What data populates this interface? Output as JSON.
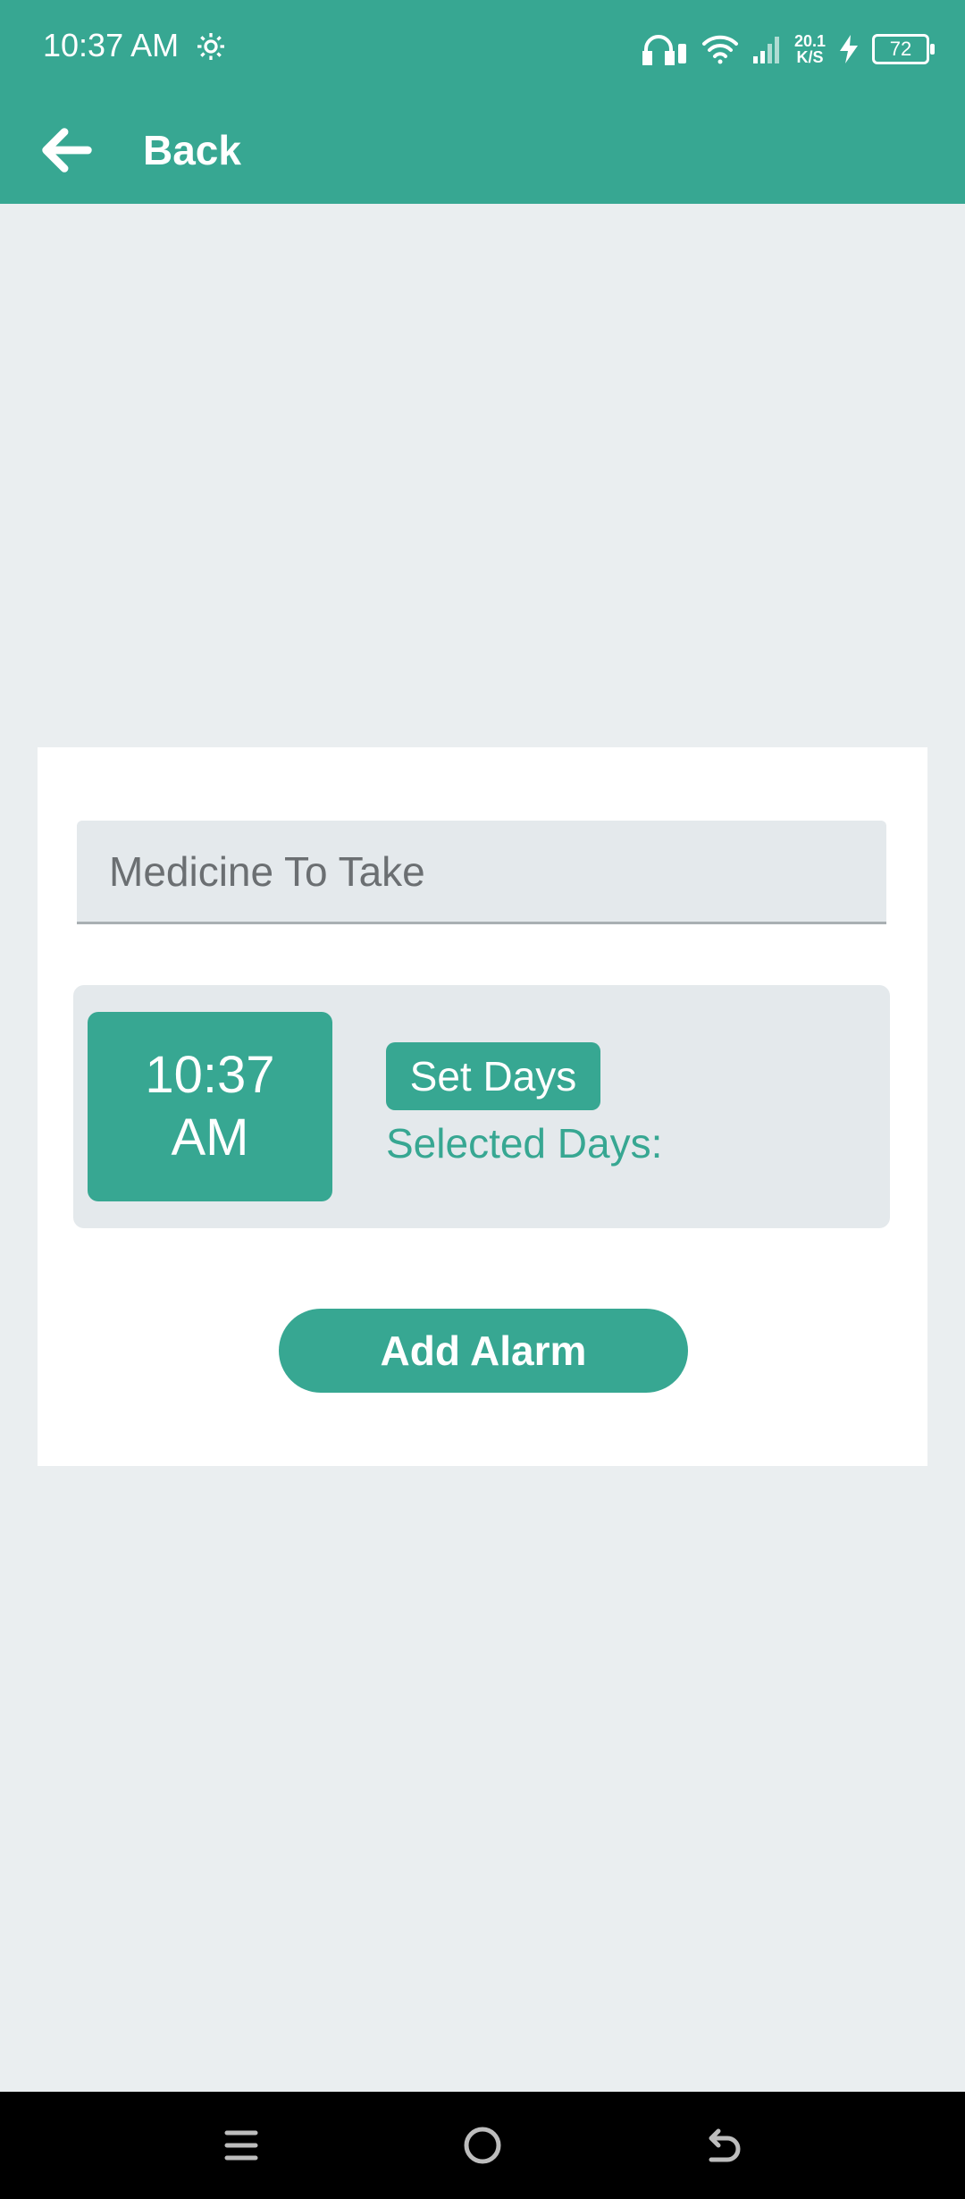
{
  "status_bar": {
    "time": "10:37 AM",
    "net_speed_value": "20.1",
    "net_speed_unit": "K/S",
    "battery_level": "72",
    "icons": [
      "gear-icon",
      "headphones-icon",
      "wifi-icon",
      "signal-icon",
      "charging-icon",
      "battery-icon"
    ]
  },
  "header": {
    "back_label": "Back",
    "accent_color": "#37a792"
  },
  "form": {
    "medicine_placeholder": "Medicine To Take",
    "medicine_value": "",
    "time_hour_min": "10:37",
    "time_ampm": "AM",
    "set_days_label": "Set Days",
    "selected_days_label": "Selected Days:",
    "add_alarm_label": "Add Alarm"
  },
  "nav_bar": {
    "buttons": [
      "menu-icon",
      "home-icon",
      "back-icon"
    ]
  }
}
